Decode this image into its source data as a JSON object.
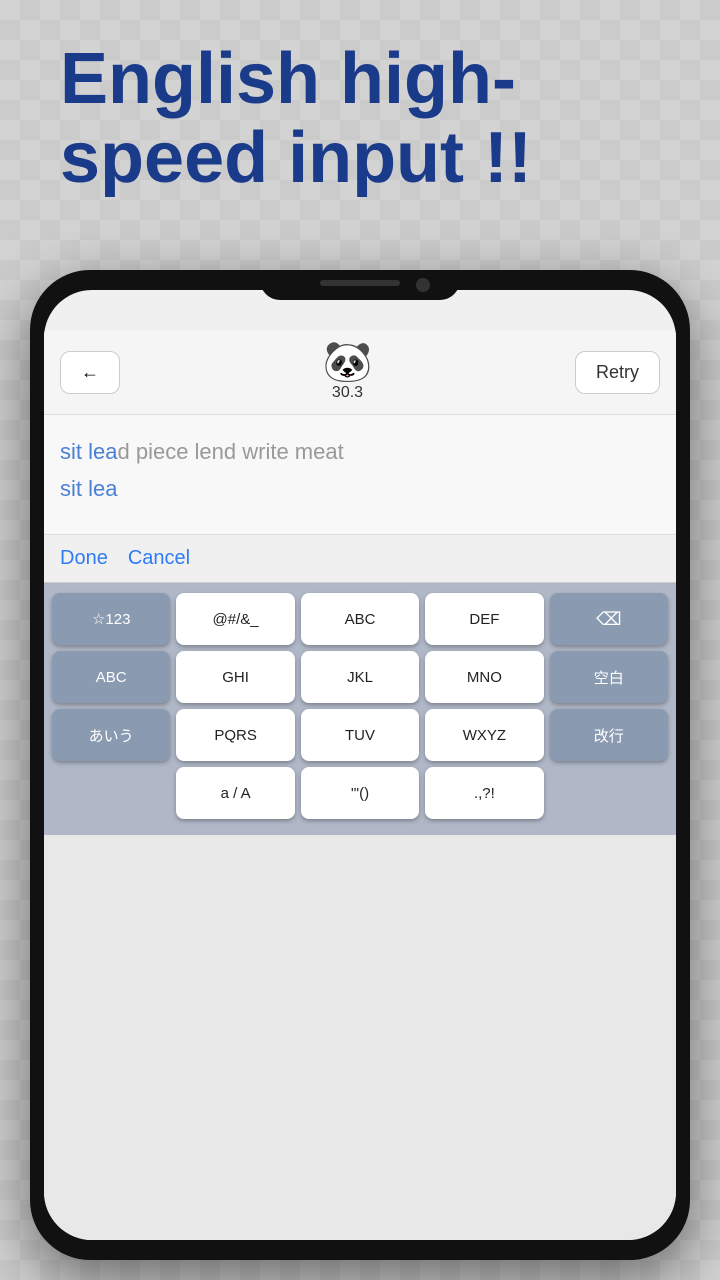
{
  "page": {
    "title_line1": "English high-",
    "title_line2": "speed input !!"
  },
  "topbar": {
    "back_arrow": "←",
    "score": "30.3",
    "retry_label": "Retry"
  },
  "text_display": {
    "target_line1_pre": "sit lea",
    "target_line1_post": "d piece lend write meat",
    "target_line2": "sit lea"
  },
  "actions": {
    "done_label": "Done",
    "cancel_label": "Cancel"
  },
  "keyboard": {
    "row1": [
      {
        "label": "☆123",
        "dark": true
      },
      {
        "label": "@#/&_",
        "dark": false
      },
      {
        "label": "ABC",
        "dark": false
      },
      {
        "label": "DEF",
        "dark": false
      },
      {
        "label": "⌫",
        "dark": true,
        "is_delete": true
      }
    ],
    "row2": [
      {
        "label": "ABC",
        "dark": true
      },
      {
        "label": "GHI",
        "dark": false
      },
      {
        "label": "JKL",
        "dark": false
      },
      {
        "label": "MNO",
        "dark": false
      },
      {
        "label": "空白",
        "dark": true
      }
    ],
    "row3_col1": {
      "label": "あいう",
      "dark": true
    },
    "row3_mid": [
      {
        "label": "PQRS",
        "dark": false
      },
      {
        "label": "TUV",
        "dark": false
      },
      {
        "label": "WXYZ",
        "dark": false
      }
    ],
    "row3_col5": {
      "label": "改行",
      "dark": true
    },
    "row4_mid": [
      {
        "label": "a / A",
        "dark": false
      },
      {
        "label": "'\"()",
        "dark": false
      },
      {
        "label": ".,?!",
        "dark": false
      }
    ]
  }
}
